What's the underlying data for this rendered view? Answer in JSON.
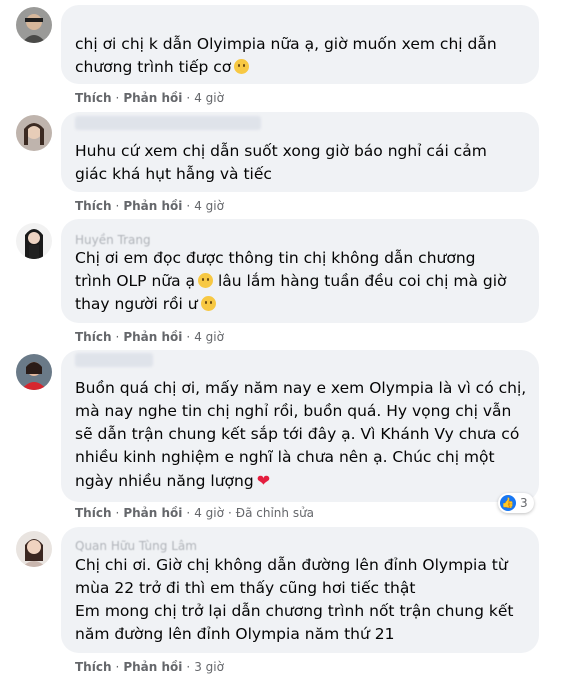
{
  "comments": [
    {
      "author": "",
      "lines": [
        "chị ơi chị k dẫn Olyimpia nữa ạ, giờ muốn xem chị dẫn",
        "chương trình tiếp cơ"
      ],
      "actions": {
        "like": "Thích",
        "reply": "Phản hồi",
        "time": "4 giờ"
      }
    },
    {
      "author": "",
      "lines": [
        "Huhu cứ xem chị dẫn suốt xong giờ báo nghỉ cái cảm",
        "giác khá hụt hẫng và tiếc"
      ],
      "actions": {
        "like": "Thích",
        "reply": "Phản hồi",
        "time": "4 giờ"
      }
    },
    {
      "author": "Huyền Trang",
      "lines": [
        "Chị ơi em đọc được thông tin chị không dẫn chương",
        "trình OLP nữa ạ",
        "lâu lắm hàng tuần đều coi chị mà giờ",
        "thay người rồi ư"
      ],
      "actions": {
        "like": "Thích",
        "reply": "Phản hồi",
        "time": "4 giờ"
      }
    },
    {
      "author": "",
      "lines": [
        "Buồn quá chị ơi, mấy năm nay e xem Olympia là vì có chị,",
        "mà nay nghe tin chị nghỉ rồi, buồn quá. Hy vọng chị vẫn",
        "sẽ dẫn trận chung kết sắp tới đây ạ. Vì Khánh Vy chưa có",
        "nhiều kinh nghiệm e nghĩ là chưa nên ạ. Chúc chị một",
        "ngày nhiều năng lượng"
      ],
      "actions": {
        "like": "Thích",
        "reply": "Phản hồi",
        "time": "4 giờ",
        "edited": "Đã chỉnh sửa"
      },
      "reactions": "3"
    },
    {
      "author": "Quan Hữu Tùng Lâm",
      "lines": [
        "Chị chi ơi. Giờ chị không dẫn đường lên đỉnh Olympia từ",
        "mùa 22 trở đi thì em thấy cũng hơi tiếc thật",
        "Em mong chị trở lại dẫn chương trình nốt trận chung kết",
        "năm đường lên đỉnh Olympia năm thứ 21"
      ],
      "actions": {
        "like": "Thích",
        "reply": "Phản hồi",
        "time": "3 giờ"
      }
    }
  ],
  "colors": {
    "bubble": "#f0f2f5",
    "text": "#050505",
    "meta": "#65676b",
    "like_blue": "#1877f2",
    "heart": "#e41e3f"
  }
}
